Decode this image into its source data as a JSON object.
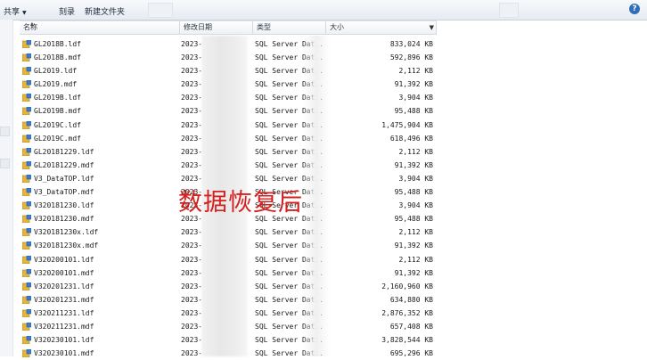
{
  "toolbar": {
    "share": "共享",
    "burn": "刻录",
    "new_folder": "新建文件夹"
  },
  "columns": {
    "name": "名称",
    "date": "修改日期",
    "type": "类型",
    "size": "大小"
  },
  "overlay_text": "数据恢复后",
  "files": [
    {
      "name": "GL2018B.ldf",
      "date": "2023-",
      "type": "SQL Server Dat...",
      "size": "833,024 KB"
    },
    {
      "name": "GL2018B.mdf",
      "date": "2023-",
      "type": "SQL Server Dat...",
      "size": "592,896 KB"
    },
    {
      "name": "GL2019.ldf",
      "date": "2023-",
      "type": "SQL Server Dat...",
      "size": "2,112 KB"
    },
    {
      "name": "GL2019.mdf",
      "date": "2023-",
      "type": "SQL Server Dat...",
      "size": "91,392 KB"
    },
    {
      "name": "GL2019B.ldf",
      "date": "2023-",
      "type": "SQL Server Dat...",
      "size": "3,904 KB"
    },
    {
      "name": "GL2019B.mdf",
      "date": "2023-",
      "type": "SQL Server Dat...",
      "size": "95,488 KB"
    },
    {
      "name": "GL2019C.ldf",
      "date": "2023-",
      "type": "SQL Server Dat...",
      "size": "1,475,904 KB"
    },
    {
      "name": "GL2019C.mdf",
      "date": "2023-",
      "type": "SQL Server Dat...",
      "size": "618,496 KB"
    },
    {
      "name": "GL20181229.ldf",
      "date": "2023-",
      "type": "SQL Server Dat...",
      "size": "2,112 KB"
    },
    {
      "name": "GL20181229.mdf",
      "date": "2023-",
      "type": "SQL Server Dat...",
      "size": "91,392 KB"
    },
    {
      "name": "V3_DataTOP.ldf",
      "date": "2023-",
      "type": "SQL Server Dat...",
      "size": "3,904 KB"
    },
    {
      "name": "V3_DataTOP.mdf",
      "date": "2023-",
      "type": "SQL Server Dat...",
      "size": "95,488 KB"
    },
    {
      "name": "V320181230.ldf",
      "date": "2023-",
      "type": "SQL Server Dat...",
      "size": "3,904 KB"
    },
    {
      "name": "V320181230.mdf",
      "date": "2023-",
      "type": "SQL Server Dat...",
      "size": "95,488 KB"
    },
    {
      "name": "V320181230x.ldf",
      "date": "2023-",
      "type": "SQL Server Dat...",
      "size": "2,112 KB"
    },
    {
      "name": "V320181230x.mdf",
      "date": "2023-",
      "type": "SQL Server Dat...",
      "size": "91,392 KB"
    },
    {
      "name": "V320200101.ldf",
      "date": "2023-",
      "type": "SQL Server Dat...",
      "size": "2,112 KB"
    },
    {
      "name": "V320200101.mdf",
      "date": "2023-",
      "type": "SQL Server Dat...",
      "size": "91,392 KB"
    },
    {
      "name": "V320201231.ldf",
      "date": "2023-",
      "type": "SQL Server Dat...",
      "size": "2,160,960 KB"
    },
    {
      "name": "V320201231.mdf",
      "date": "2023-",
      "type": "SQL Server Dat...",
      "size": "634,880 KB"
    },
    {
      "name": "V320211231.ldf",
      "date": "2023-",
      "type": "SQL Server Dat...",
      "size": "2,876,352 KB"
    },
    {
      "name": "V320211231.mdf",
      "date": "2023-",
      "type": "SQL Server Dat...",
      "size": "657,408 KB"
    },
    {
      "name": "V320230101.ldf",
      "date": "2023-",
      "type": "SQL Server Dat...",
      "size": "3,828,544 KB"
    },
    {
      "name": "V320230101.mdf",
      "date": "2023-",
      "type": "SQL Server Dat...",
      "size": "695,296 KB"
    }
  ],
  "colors": {
    "overlay": "#d62020",
    "icon_gold": "#e6b43a",
    "icon_blue": "#3a7bd5"
  },
  "icons": {
    "toolbar_help": "help-icon",
    "file": "database-file-icon"
  }
}
